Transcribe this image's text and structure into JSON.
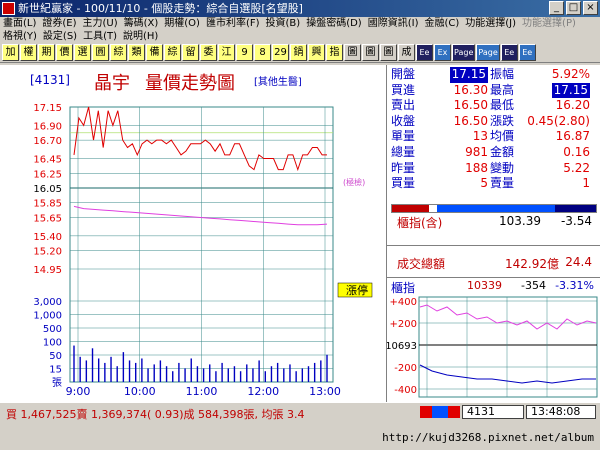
{
  "window": {
    "title": "新世紀贏家 - 100/11/10 - 個股走勢：綜合自選股[名望股]"
  },
  "menu": {
    "row1": [
      "畫面(L)",
      "證券(E)",
      "主力(U)",
      "籌碼(X)",
      "期權(O)",
      "匯市利率(F)",
      "投資(B)",
      "操盤密碼(D)",
      "國際資訊(I)",
      "金融(C)",
      "功能選擇(J)",
      "功能選擇(P)"
    ],
    "row2": [
      "格視(Y)",
      "設定(S)",
      "工具(T)",
      "說明(H)"
    ]
  },
  "toolbar": [
    "加",
    "權",
    "期",
    "價",
    "選",
    "圓",
    "綜",
    "類",
    "備",
    "綜",
    "留",
    "委",
    "江",
    "9",
    "8",
    "29",
    "鍋",
    "興",
    "指",
    "圖",
    "圖",
    "圖",
    "成",
    "Ee",
    "Ex",
    "Page",
    "Page",
    "Ee",
    "Ee"
  ],
  "stock": {
    "code": "[4131]",
    "name": "晶宇",
    "chart_title": "量價走勢圖",
    "industry": "[其他生醫]"
  },
  "quote": [
    {
      "l1": "開盤",
      "v1": "17.15",
      "l2": "振幅",
      "v2": "5.92%",
      "c1": "#ffffff",
      "b1": "#0000c0",
      "c2": "#e00000",
      "b2": ""
    },
    {
      "l1": "買進",
      "v1": "16.30",
      "l2": "最高",
      "v2": "17.15",
      "c1": "#e00000",
      "b1": "",
      "c2": "#ffffff",
      "b2": "#0000c0"
    },
    {
      "l1": "賣出",
      "v1": "16.50",
      "l2": "最低",
      "v2": "16.20",
      "c1": "#e00000",
      "b1": "",
      "c2": "#e00000",
      "b2": ""
    },
    {
      "l1": "收盤",
      "v1": "16.50",
      "l2": "漲跌",
      "v2": "0.45(2.80)",
      "c1": "#e00000",
      "b1": "",
      "c2": "#e00000",
      "b2": ""
    },
    {
      "l1": "單量",
      "v1": "13",
      "l2": "均價",
      "v2": "16.87",
      "c1": "#e00000",
      "b1": "",
      "c2": "#e00000",
      "b2": ""
    },
    {
      "l1": "總量",
      "v1": "981",
      "l2": "金額",
      "v2": "0.16",
      "c1": "#e00000",
      "b1": "",
      "c2": "#e00000",
      "b2": ""
    },
    {
      "l1": "昨量",
      "v1": "188",
      "l2": "變動",
      "v2": "5.22",
      "c1": "#e00000",
      "b1": "",
      "c2": "#e00000",
      "b2": ""
    },
    {
      "l1": "買量",
      "v1": "5",
      "l2": "賣量",
      "v2": "1",
      "c1": "#e00000",
      "b1": "",
      "c2": "#e00000",
      "b2": ""
    }
  ],
  "index": {
    "label": "櫃指(含)",
    "value": "103.39",
    "change": "-3.54",
    "vol_label": "成交總額",
    "vol_value": "142.92億",
    "vol_change": "24.4"
  },
  "mini": {
    "title": "櫃指",
    "value": "10339",
    "change": "-354",
    "pct": "-3.31%",
    "ticks": [
      "+400",
      "+200",
      "10693",
      "-200",
      "-400"
    ]
  },
  "chart_data": {
    "type": "line",
    "price_ticks": [
      "17.15",
      "16.90",
      "16.70",
      "16.45",
      "16.25",
      "16.05",
      "15.85",
      "15.65",
      "15.40",
      "15.20",
      "14.95"
    ],
    "volume_ticks": [
      "3,000",
      "1,000",
      "500",
      "100",
      "50",
      "15",
      "張"
    ],
    "x_ticks": [
      "9:00",
      "10:00",
      "11:00",
      "12:00",
      "13:00"
    ],
    "ref_price": "16.05",
    "ref_label": "(極檢)",
    "lock_label": "漲停",
    "series": [
      {
        "values": [
          16.5,
          17.0,
          16.9,
          17.15,
          16.7,
          17.1,
          16.6,
          17.1,
          16.9,
          17.1,
          16.7,
          16.6,
          16.65,
          16.5,
          16.65,
          16.7,
          16.65,
          16.7,
          16.7,
          16.65,
          16.7,
          16.6,
          16.5,
          16.55,
          16.65,
          16.65,
          16.65,
          16.7,
          16.65,
          16.55,
          16.65,
          16.5,
          16.5,
          16.65,
          16.65,
          16.5,
          16.35,
          16.3,
          16.5,
          16.45,
          16.45,
          16.45,
          16.3,
          16.3,
          16.5,
          16.5,
          16.3,
          16.5,
          16.5,
          16.6,
          16.6,
          16.5,
          16.5
        ]
      },
      {
        "values": [
          15.8,
          15.77,
          15.76,
          15.75,
          15.74,
          15.73,
          15.72,
          15.71,
          15.7,
          15.69,
          15.68,
          15.67,
          15.66,
          15.65,
          15.64,
          15.63,
          15.62,
          15.61,
          15.6,
          15.59,
          15.58,
          15.57,
          15.56,
          15.55,
          15.55,
          15.55,
          15.56
        ]
      }
    ],
    "volume": [
      40,
      12,
      8,
      30,
      10,
      6,
      12,
      4,
      20,
      8,
      6,
      10,
      3,
      5,
      8,
      4,
      2,
      6,
      3,
      10,
      4,
      3,
      5,
      2,
      6,
      3,
      4,
      2,
      5,
      3,
      8,
      2,
      4,
      6,
      3,
      5,
      2,
      3,
      4,
      6,
      8,
      15
    ]
  },
  "status": {
    "text": "買 1,467,525賣 1,369,374( 0.93)成 584,398張, 均張 3.4",
    "code": "4131",
    "time": "13:48:08"
  },
  "footer": {
    "url": "http://kujd3268.pixnet.net/album"
  }
}
